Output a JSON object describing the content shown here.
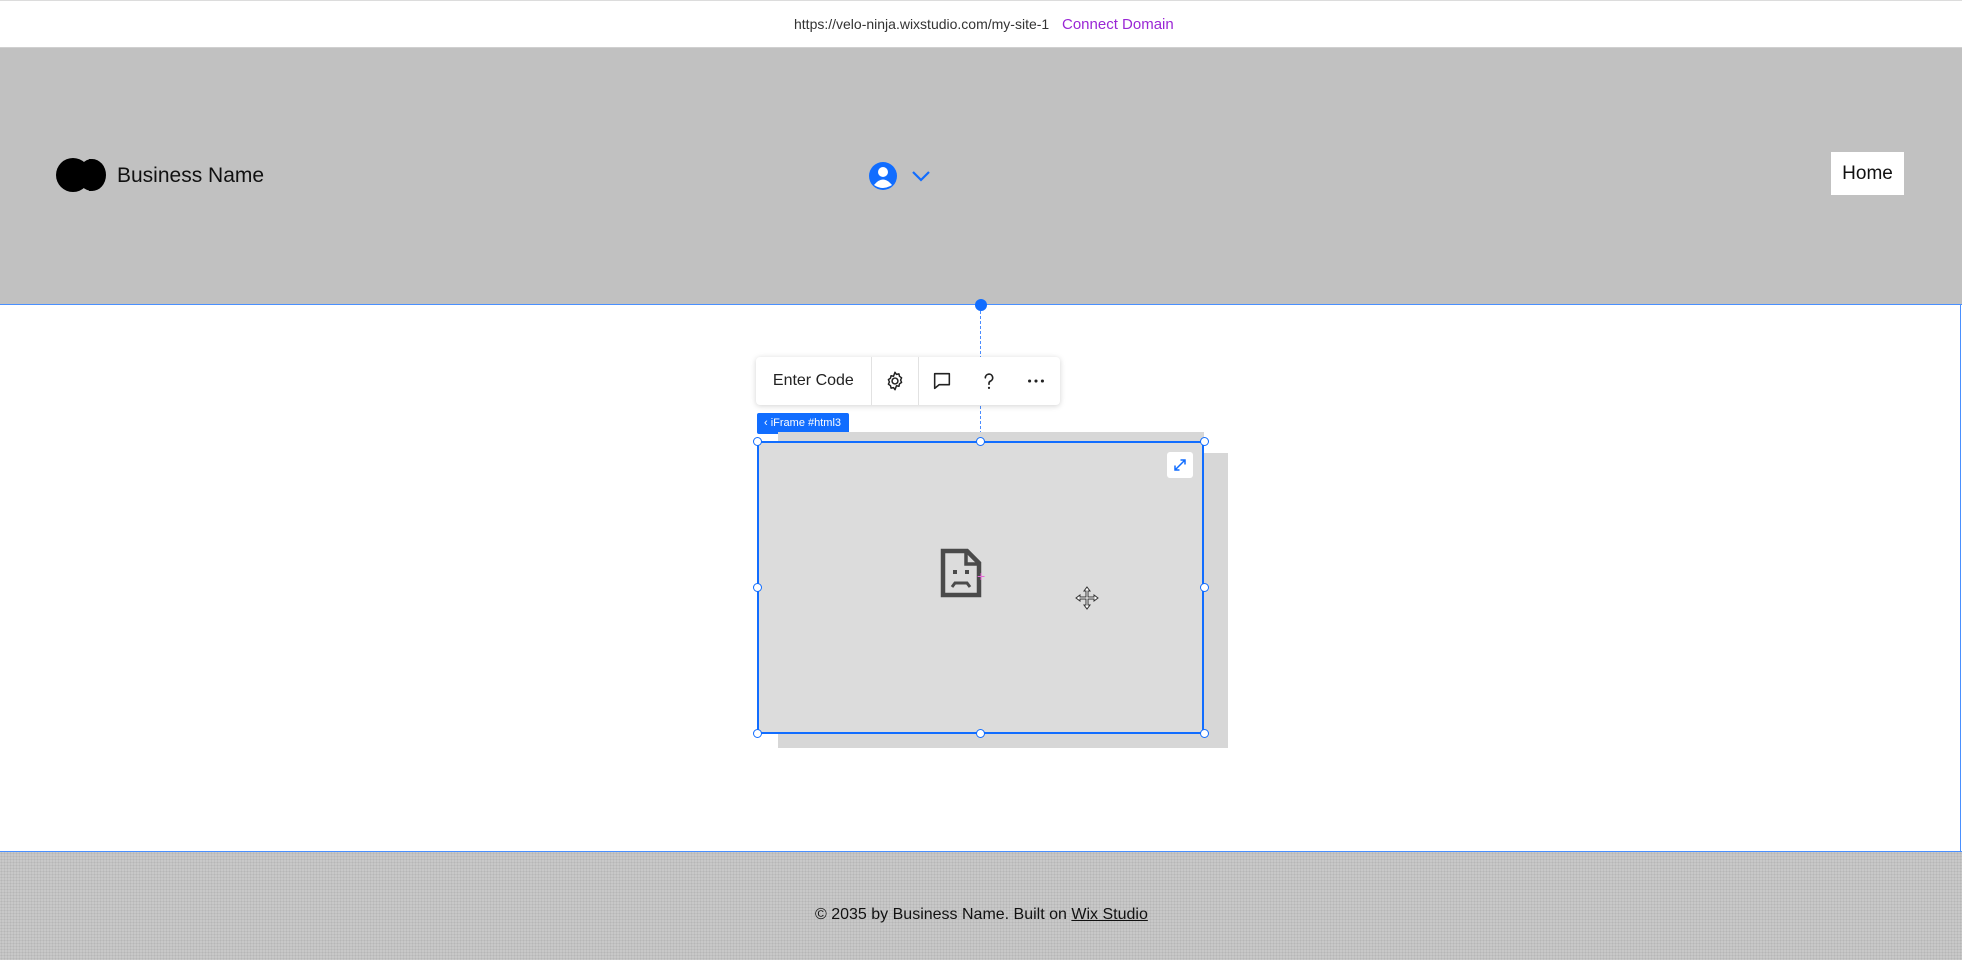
{
  "url_bar": {
    "url": "https://velo-ninja.wixstudio.com/my-site-1",
    "connect_label": "Connect Domain"
  },
  "header": {
    "business_name": "Business Name",
    "home_label": "Home",
    "logo_icon": "logo-two-circles",
    "member_icon": "user-avatar-icon"
  },
  "toolbar": {
    "enter_code_label": "Enter Code",
    "icons": [
      "gear-icon",
      "comment-icon",
      "help-icon",
      "more-icon"
    ]
  },
  "element": {
    "tag_label": "‹ iFrame #html3",
    "placeholder_icon": "broken-page-icon"
  },
  "footer": {
    "copyright_prefix": "© 2035 by Business Name. Built on ",
    "link_label": "Wix Studio"
  },
  "colors": {
    "selection": "#116dff",
    "connect": "#9a27d5",
    "header_bg": "#c1c1c1"
  }
}
